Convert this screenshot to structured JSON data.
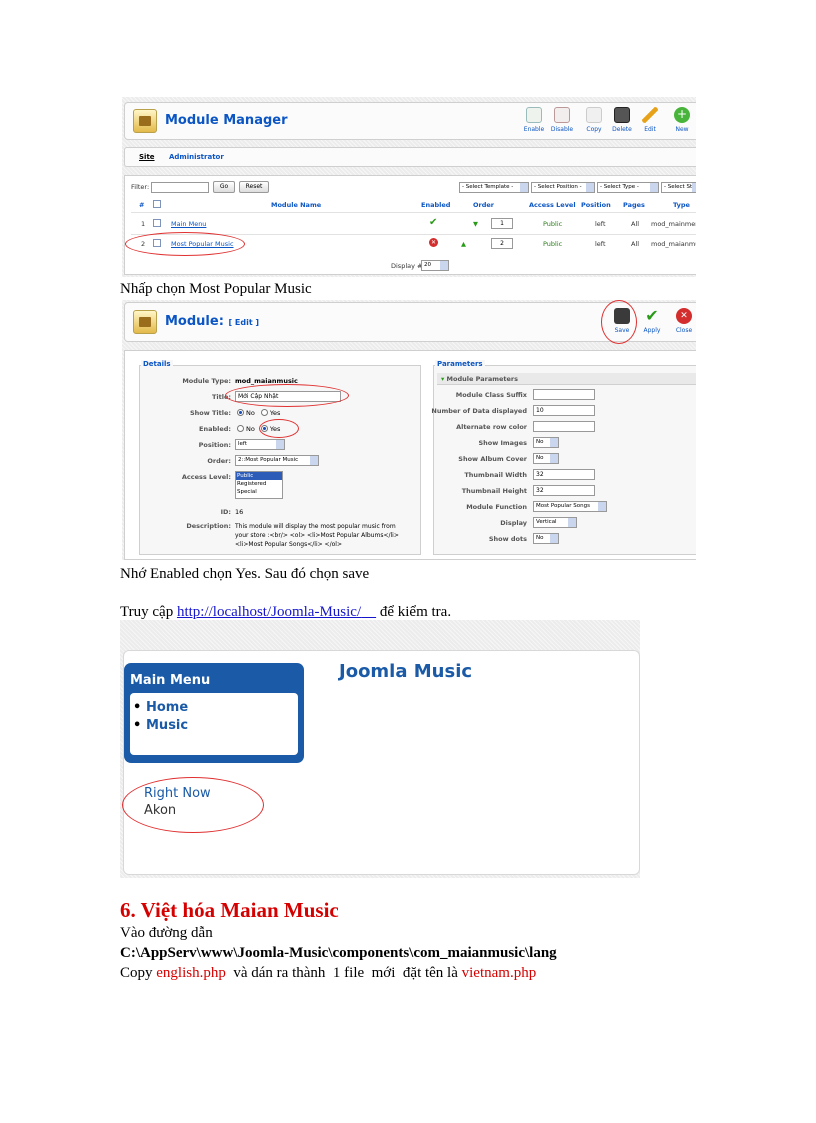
{
  "shot1": {
    "title": "Module Manager",
    "toolbar": [
      "Enable",
      "Disable",
      "Copy",
      "Delete",
      "Edit",
      "New"
    ],
    "tabs": [
      "Site",
      "Administrator"
    ],
    "filter_label": "Filter:",
    "go": "Go",
    "reset": "Reset",
    "selects": [
      "- Select Template -",
      "- Select Position -",
      "- Select Type -",
      "- Select Sta"
    ],
    "headers": [
      "#",
      "Module Name",
      "Enabled",
      "Order",
      "Access Level",
      "Position",
      "Pages",
      "Type"
    ],
    "rows": [
      {
        "num": "1",
        "name": "Main Menu",
        "order": "1",
        "access": "Public",
        "position": "left",
        "pages": "All",
        "type": "mod_mainmenu"
      },
      {
        "num": "2",
        "name": "Most Popular Music",
        "order": "2",
        "access": "Public",
        "position": "left",
        "pages": "All",
        "type": "mod_maianmus"
      }
    ],
    "display": "Display #",
    "display_value": "20"
  },
  "caption1": "Nhấp chọn Most Popular Music",
  "shot2": {
    "title": "Module:",
    "title_sub": "[ Edit ]",
    "toolbar": [
      "Save",
      "Apply",
      "Close"
    ],
    "details_legend": "Details",
    "details": [
      {
        "label": "Module Type:",
        "value": "mod_maianmusic"
      },
      {
        "label": "Title:",
        "value": "Mới Cập Nhật"
      },
      {
        "label": "Show Title:",
        "no": "No",
        "yes": "Yes"
      },
      {
        "label": "Enabled:",
        "no": "No",
        "yes": "Yes"
      },
      {
        "label": "Position:",
        "value": "left"
      },
      {
        "label": "Order:",
        "value": "2::Most Popular Music"
      },
      {
        "label": "Access Level:",
        "options": [
          "Public",
          "Registered",
          "Special"
        ]
      },
      {
        "label": "ID:",
        "value": "16"
      },
      {
        "label": "Description:",
        "value": "This module will display the most popular music from your store :<br/> <ol> <li>Most Popular Albums</li> <li>Most Popular Songs</li> </ol>"
      }
    ],
    "params_legend": "Parameters",
    "params_header": "Module Parameters",
    "params": [
      {
        "label": "Module Class Suffix",
        "value": ""
      },
      {
        "label": "Number of Data displayed",
        "value": "10"
      },
      {
        "label": "Alternate row color",
        "value": ""
      },
      {
        "label": "Show Images",
        "value": "No"
      },
      {
        "label": "Show Album Cover",
        "value": "No"
      },
      {
        "label": "Thumbnail Width",
        "value": "32"
      },
      {
        "label": "Thumbnail Height",
        "value": "32"
      },
      {
        "label": "Module Function",
        "value": "Most Popular Songs"
      },
      {
        "label": "Display",
        "value": "Vertical"
      },
      {
        "label": "Show dots",
        "value": "No"
      }
    ]
  },
  "caption2": "Nhớ Enabled chọn Yes. Sau đó chọn save",
  "caption3": {
    "prefix": "Truy cập ",
    "link": "http://localhost/Joomla-Music/",
    "suffix": " để kiểm tra."
  },
  "shot3": {
    "menu_title": "Main Menu",
    "menu_items": [
      "Home",
      "Music"
    ],
    "site_title": "Joomla Music",
    "song": "Right Now",
    "artist": "Akon"
  },
  "section": {
    "heading": "6. Việt hóa Maian Music",
    "line1": "Vào đường dẫn",
    "path": "C:\\AppServ\\www\\Joomla-Music\\components\\com_maianmusic\\lang",
    "line3_prefix": "Copy ",
    "file1": "english.php",
    "line3_mid": "  và dán ra thành  1 file  mới  đặt tên là ",
    "file2": "vietnam.php"
  }
}
